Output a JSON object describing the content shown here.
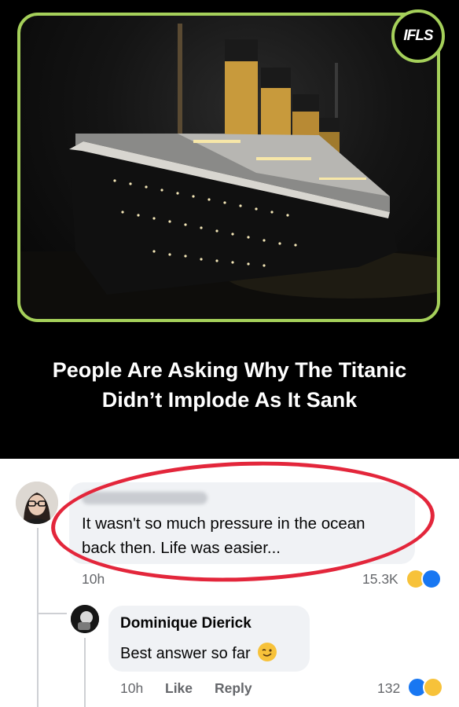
{
  "badge": {
    "label": "IFLS"
  },
  "headline": {
    "line1": "People Are Asking Why The Titanic",
    "line2": "Didn’t Implode As It Sank"
  },
  "comment1": {
    "text_line1": "It wasn't so much pressure in the ocean",
    "text_line2": "back then. Life was easier...",
    "time": "10h",
    "count": "15.3K",
    "reactions": [
      "haha-icon",
      "like-icon"
    ]
  },
  "reply1": {
    "author": "Dominique Dierick",
    "text": "Best answer so far",
    "emoji": "wink-emoji",
    "time": "10h",
    "like_label": "Like",
    "reply_label": "Reply",
    "count": "132",
    "reactions": [
      "like-icon",
      "haha-icon"
    ]
  },
  "colors": {
    "frame": "#a5d05a",
    "circle": "#e3263b",
    "bubble": "#f0f2f5",
    "meta": "#65676b"
  }
}
